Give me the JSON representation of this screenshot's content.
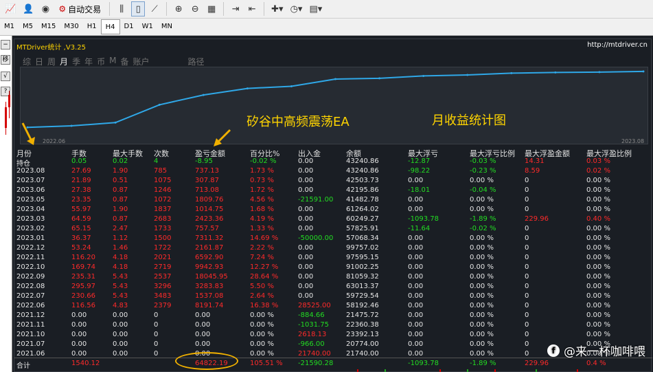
{
  "toolbar": {
    "auto_trading_label": "自动交易",
    "icons": [
      "new-chart-icon",
      "navigator-icon",
      "market-watch-icon",
      "auto-trading-icon",
      "bar-chart-icon",
      "candlestick-icon",
      "line-chart-icon",
      "zoom-in-icon",
      "zoom-out-icon",
      "tile-windows-icon",
      "chart-shift-icon",
      "autoscroll-icon",
      "indicators-icon",
      "periods-icon",
      "templates-icon"
    ]
  },
  "timeframes": [
    "M1",
    "M5",
    "M15",
    "M30",
    "H1",
    "H4",
    "D1",
    "W1",
    "MN"
  ],
  "active_timeframe": "H4",
  "left_strip": [
    "移",
    "√",
    "?"
  ],
  "panel": {
    "title": "MTDriver统计 ,V3.25",
    "url": "http://mtdriver.cn",
    "tabs": [
      "综",
      "日",
      "周",
      "月",
      "季",
      "年",
      "币",
      "M",
      "备",
      "账户",
      "路径"
    ],
    "active_tab": "月",
    "chart_start_label": "2022.06",
    "chart_end_label": "2023.08"
  },
  "annotations": {
    "ea_label": "矽谷中高频震荡EA",
    "stats_label": "月收益统计图"
  },
  "table": {
    "headers": [
      "月份",
      "手数",
      "最大手数",
      "次数",
      "盈亏金额",
      "百分比%",
      "出入金",
      "余额",
      "最大浮亏",
      "最大浮亏比例",
      "最大浮盈金额",
      "最大浮盈比例"
    ],
    "holding_row": [
      "持仓",
      "0.05",
      "0.02",
      "4",
      "-8.95",
      "-0.02 %",
      "0.00",
      "43240.86",
      "-12.87",
      "-0.03 %",
      "14.31",
      "0.03 %"
    ],
    "rows": [
      [
        "2023.08",
        "27.69",
        "1.90",
        "785",
        "737.13",
        "1.73 %",
        "0.00",
        "43240.86",
        "-98.22",
        "-0.23 %",
        "8.59",
        "0.02 %"
      ],
      [
        "2023.07",
        "21.89",
        "0.51",
        "1075",
        "307.87",
        "0.73 %",
        "0.00",
        "42503.73",
        "0.00",
        "0.00 %",
        "0",
        "0.00 %"
      ],
      [
        "2023.06",
        "27.38",
        "0.87",
        "1246",
        "713.08",
        "1.72 %",
        "0.00",
        "42195.86",
        "-18.01",
        "-0.04 %",
        "0",
        "0.00 %"
      ],
      [
        "2023.05",
        "23.35",
        "0.87",
        "1072",
        "1809.76",
        "4.56 %",
        "-21591.00",
        "41482.78",
        "0.00",
        "0.00 %",
        "0",
        "0.00 %"
      ],
      [
        "2023.04",
        "55.97",
        "1.90",
        "1837",
        "1014.75",
        "1.68 %",
        "0.00",
        "61264.02",
        "0.00",
        "0.00 %",
        "0",
        "0.00 %"
      ],
      [
        "2023.03",
        "64.59",
        "0.87",
        "2683",
        "2423.36",
        "4.19 %",
        "0.00",
        "60249.27",
        "-1093.78",
        "-1.89 %",
        "229.96",
        "0.40 %"
      ],
      [
        "2023.02",
        "65.15",
        "2.47",
        "1733",
        "757.57",
        "1.33 %",
        "0.00",
        "57825.91",
        "-11.64",
        "-0.02 %",
        "0",
        "0.00 %"
      ],
      [
        "2023.01",
        "36.37",
        "1.12",
        "1500",
        "7311.32",
        "14.69 %",
        "-50000.00",
        "57068.34",
        "0.00",
        "0.00 %",
        "0",
        "0.00 %"
      ],
      [
        "2022.12",
        "53.24",
        "1.46",
        "1722",
        "2161.87",
        "2.22 %",
        "0.00",
        "99757.02",
        "0.00",
        "0.00 %",
        "0",
        "0.00 %"
      ],
      [
        "2022.11",
        "116.20",
        "4.18",
        "2021",
        "6592.90",
        "7.24 %",
        "0.00",
        "97595.15",
        "0.00",
        "0.00 %",
        "0",
        "0.00 %"
      ],
      [
        "2022.10",
        "169.74",
        "4.18",
        "2719",
        "9942.93",
        "12.27 %",
        "0.00",
        "91002.25",
        "0.00",
        "0.00 %",
        "0",
        "0.00 %"
      ],
      [
        "2022.09",
        "235.31",
        "5.43",
        "2537",
        "18045.95",
        "28.64 %",
        "0.00",
        "81059.32",
        "0.00",
        "0.00 %",
        "0",
        "0.00 %"
      ],
      [
        "2022.08",
        "295.97",
        "5.43",
        "3296",
        "3283.83",
        "5.50 %",
        "0.00",
        "63013.37",
        "0.00",
        "0.00 %",
        "0",
        "0.00 %"
      ],
      [
        "2022.07",
        "230.66",
        "5.43",
        "3483",
        "1537.08",
        "2.64 %",
        "0.00",
        "59729.54",
        "0.00",
        "0.00 %",
        "0",
        "0.00 %"
      ],
      [
        "2022.06",
        "116.56",
        "4.83",
        "2379",
        "8191.74",
        "16.38 %",
        "28525.00",
        "58192.46",
        "0.00",
        "0.00 %",
        "0",
        "0.00 %"
      ],
      [
        "2021.12",
        "0.00",
        "0.00",
        "0",
        "0.00",
        "0.00 %",
        "-884.66",
        "21475.72",
        "0.00",
        "0.00 %",
        "0",
        "0.00 %"
      ],
      [
        "2021.11",
        "0.00",
        "0.00",
        "0",
        "0.00",
        "0.00 %",
        "-1031.75",
        "22360.38",
        "0.00",
        "0.00 %",
        "0",
        "0.00 %"
      ],
      [
        "2021.10",
        "0.00",
        "0.00",
        "0",
        "0.00",
        "0.00 %",
        "2618.13",
        "23392.13",
        "0.00",
        "0.00 %",
        "0",
        "0.00 %"
      ],
      [
        "2021.07",
        "0.00",
        "0.00",
        "0",
        "0.00",
        "0.00 %",
        "-966.00",
        "20774.00",
        "0.00",
        "0.00 %",
        "0",
        "0.00 %"
      ],
      [
        "2021.06",
        "0.00",
        "0.00",
        "0",
        "0.00",
        "0.00 %",
        "21740.00",
        "21740.00",
        "0.00",
        "0.00 %",
        "0",
        "0.00 %"
      ]
    ],
    "total_row": [
      "合计",
      "1540.12",
      "",
      "",
      "64822.19",
      "105.51 %",
      "-21590.28",
      "",
      "-1093.78",
      "-1.89 %",
      "229.96",
      "0.4 %"
    ]
  },
  "watermark": "@来一杯咖啡喂",
  "watermark_logo": "f",
  "colors": {
    "accent_yellow": "#ffd400",
    "line_blue": "#2fa8e8",
    "positive_red": "#ff2a2a",
    "negative_green": "#22dd22",
    "highlight_orange": "#f0b000"
  },
  "chart_data": {
    "type": "line",
    "title": "",
    "xlabel": "",
    "ylabel": "",
    "x": [
      "2022.06",
      "2022.07",
      "2022.08",
      "2022.09",
      "2022.10",
      "2022.11",
      "2022.12",
      "2023.01",
      "2023.02",
      "2023.03",
      "2023.04",
      "2023.05",
      "2023.06",
      "2023.07",
      "2023.08"
    ],
    "series": [
      {
        "values": [
          8191.74,
          9728.82,
          13012.65,
          31058.6,
          41001.53,
          47594.43,
          49756.3,
          57067.62,
          57825.19,
          60248.55,
          61263.3,
          63073.06,
          63786.14,
          64094.01,
          64831.14
        ]
      }
    ],
    "grid": false,
    "legend": "none"
  }
}
